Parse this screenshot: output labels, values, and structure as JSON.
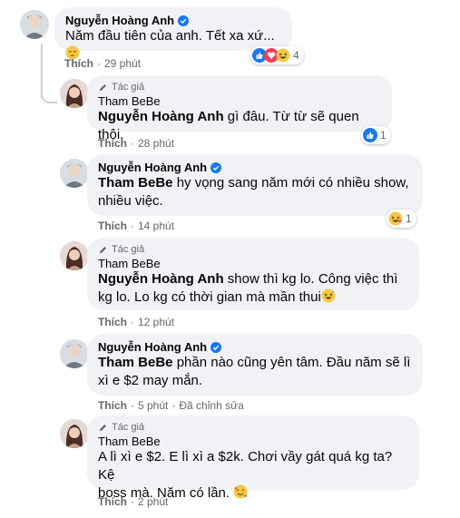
{
  "comments": [
    {
      "author": "Nguyễn Hoàng Anh",
      "verified": true,
      "text": "Năm đầu tiên của anh. Tết xa xứ...",
      "like_label": "Thích",
      "time": "29 phút",
      "reaction_count": "4",
      "reactions": [
        "like-icon",
        "love-icon",
        "laugh-icon"
      ]
    },
    {
      "badge": "Tác giả",
      "author": "Tham BeBe",
      "mention": "Nguyễn Hoàng Anh",
      "text": " gì đâu. Từ từ sẽ quen thôi.",
      "like_label": "Thích",
      "time": "28 phút",
      "reaction_count": "1",
      "reactions": [
        "like-icon"
      ]
    },
    {
      "author": "Nguyễn Hoàng Anh",
      "verified": true,
      "mention": "Tham BeBe",
      "text_line1": " hy vọng sang năm mới có nhiều show,",
      "text_line2": "nhiều việc.",
      "like_label": "Thích",
      "time": "14 phút",
      "reaction_count": "1",
      "reactions": [
        "haha-icon"
      ]
    },
    {
      "badge": "Tác giả",
      "author": "Tham BeBe",
      "mention": "Nguyễn Hoàng Anh",
      "text_line1": " show thì kg lo. Công việc thì",
      "text_line2": "kg lo. Lo kg có thời gian mà mần thui",
      "like_label": "Thích",
      "time": "12 phút"
    },
    {
      "author": "Nguyễn Hoàng Anh",
      "verified": true,
      "mention": "Tham BeBe",
      "text_line1": " phần nào cũng yên tâm. Đầu năm sẽ lì",
      "text_line2": "xì e $2 may mắn.",
      "like_label": "Thích",
      "time": "5 phút",
      "edited": "Đã chỉnh sửa"
    },
    {
      "badge": "Tác giả",
      "author": "Tham BeBe",
      "text_line1": "A lì xì e $2. E lì xì a $2k. Chơi vầy gát quá kg ta? Kệ",
      "text_line2": "boss mà. Năm có lần.",
      "like_label": "Thích",
      "time": "2 phút"
    }
  ],
  "colors": {
    "bubble": "#f0f2f5",
    "meta": "#65676b",
    "verified": "#1877f2",
    "like": "#1877f2",
    "love": "#f33e58"
  }
}
